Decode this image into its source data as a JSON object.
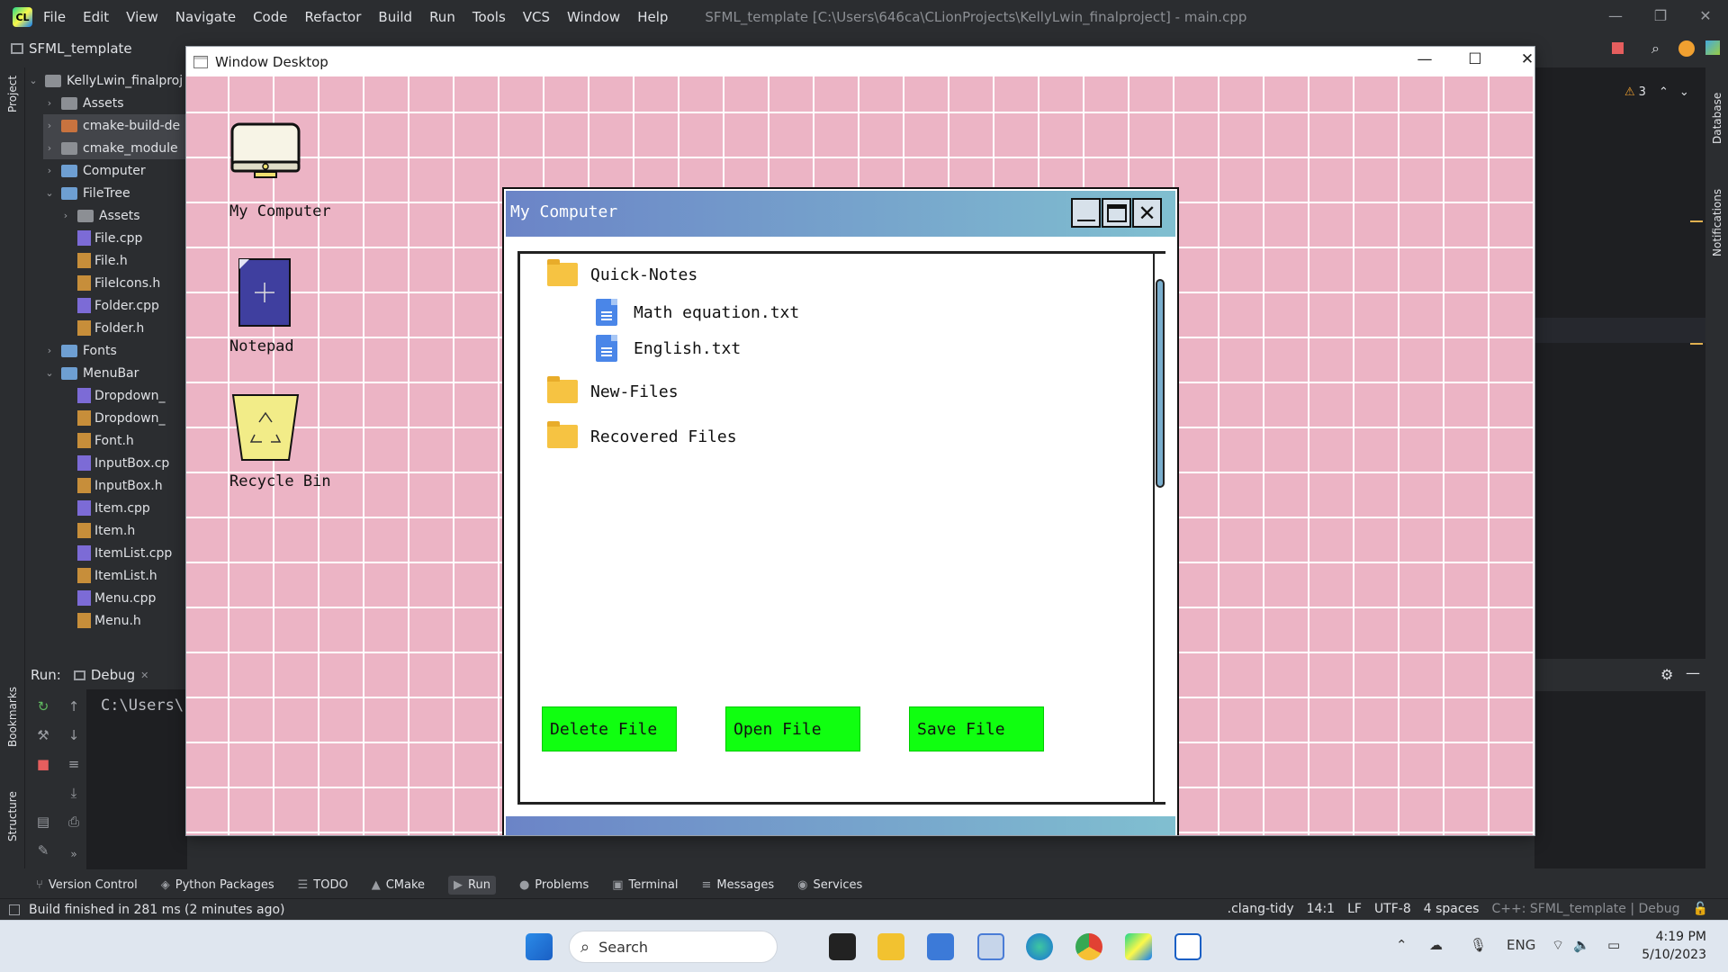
{
  "ide": {
    "menu": [
      "File",
      "Edit",
      "View",
      "Navigate",
      "Code",
      "Refactor",
      "Build",
      "Run",
      "Tools",
      "VCS",
      "Window",
      "Help"
    ],
    "title": "SFML_template [C:\\Users\\646ca\\CLionProjects\\KellyLwin_finalproject] - main.cpp",
    "project_name": "SFML_template",
    "project_panel_label": "Project",
    "tree": [
      {
        "label": "KellyLwin_finalproj",
        "kind": "folder-gray",
        "depth": 0,
        "state": "open"
      },
      {
        "label": "Assets",
        "kind": "folder-gray",
        "depth": 1,
        "state": "closed"
      },
      {
        "label": "cmake-build-de",
        "kind": "folder-orange",
        "depth": 1,
        "state": "closed"
      },
      {
        "label": "cmake_module",
        "kind": "folder-gray",
        "depth": 1,
        "state": "closed"
      },
      {
        "label": "Computer",
        "kind": "folder",
        "depth": 1,
        "state": "closed"
      },
      {
        "label": "FileTree",
        "kind": "folder",
        "depth": 1,
        "state": "open"
      },
      {
        "label": "Assets",
        "kind": "folder-gray",
        "depth": 2,
        "state": "closed"
      },
      {
        "label": "File.cpp",
        "kind": "cpp",
        "depth": 2
      },
      {
        "label": "File.h",
        "kind": "h",
        "depth": 2
      },
      {
        "label": "FileIcons.h",
        "kind": "h",
        "depth": 2
      },
      {
        "label": "Folder.cpp",
        "kind": "cpp",
        "depth": 2
      },
      {
        "label": "Folder.h",
        "kind": "h",
        "depth": 2
      },
      {
        "label": "Fonts",
        "kind": "folder",
        "depth": 1,
        "state": "closed"
      },
      {
        "label": "MenuBar",
        "kind": "folder",
        "depth": 1,
        "state": "open"
      },
      {
        "label": "Dropdown_",
        "kind": "cpp",
        "depth": 2
      },
      {
        "label": "Dropdown_",
        "kind": "h",
        "depth": 2
      },
      {
        "label": "Font.h",
        "kind": "h",
        "depth": 2
      },
      {
        "label": "InputBox.cp",
        "kind": "cpp",
        "depth": 2
      },
      {
        "label": "InputBox.h",
        "kind": "h",
        "depth": 2
      },
      {
        "label": "Item.cpp",
        "kind": "cpp",
        "depth": 2
      },
      {
        "label": "Item.h",
        "kind": "h",
        "depth": 2
      },
      {
        "label": "ItemList.cpp",
        "kind": "cpp",
        "depth": 2
      },
      {
        "label": "ItemList.h",
        "kind": "h",
        "depth": 2
      },
      {
        "label": "Menu.cpp",
        "kind": "cpp",
        "depth": 2
      },
      {
        "label": "Menu.h",
        "kind": "h",
        "depth": 2
      }
    ],
    "run_label": "Run:",
    "run_tab": "Debug",
    "console_text": "C:\\Users\\",
    "side_labels": {
      "project": "Project",
      "bookmarks": "Bookmarks",
      "structure": "Structure",
      "database": "Database",
      "notifications": "Notifications"
    },
    "warnings_count": "3",
    "tool_tabs": [
      {
        "label": "Version Control",
        "icon": "branch-icon"
      },
      {
        "label": "Python Packages",
        "icon": "layers-icon"
      },
      {
        "label": "TODO",
        "icon": "list-icon"
      },
      {
        "label": "CMake",
        "icon": "triangle-icon"
      },
      {
        "label": "Run",
        "icon": "play-icon",
        "active": true
      },
      {
        "label": "Problems",
        "icon": "info-icon"
      },
      {
        "label": "Terminal",
        "icon": "terminal-icon"
      },
      {
        "label": "Messages",
        "icon": "menu-icon"
      },
      {
        "label": "Services",
        "icon": "play-circle-icon"
      }
    ],
    "status": {
      "message": "Build finished in 281 ms (2 minutes ago)",
      "right": [
        ".clang-tidy",
        "14:1",
        "LF",
        "UTF-8",
        "4 spaces",
        "C++: SFML_template | Debug"
      ]
    }
  },
  "sfml": {
    "window_title": "Window Desktop",
    "desktop_icons": [
      {
        "label": "My Computer",
        "icon": "monitor-icon"
      },
      {
        "label": "Notepad",
        "icon": "notepad-icon"
      },
      {
        "label": "Recycle Bin",
        "icon": "recycle-bin-icon"
      }
    ],
    "my_computer": {
      "title": "My Computer",
      "tree": [
        {
          "label": "Quick-Notes",
          "type": "folder",
          "depth": 0
        },
        {
          "label": "Math equation.txt",
          "type": "file",
          "depth": 1
        },
        {
          "label": "English.txt",
          "type": "file",
          "depth": 1
        },
        {
          "label": "New-Files",
          "type": "folder",
          "depth": 0
        },
        {
          "label": "Recovered Files",
          "type": "folder",
          "depth": 0
        }
      ],
      "buttons": [
        "Delete File",
        "Open File",
        "Save File"
      ],
      "button_color": "#10ff10",
      "titlebar_gradient": [
        "#6b84c7",
        "#80bfd0"
      ]
    }
  },
  "taskbar": {
    "search_placeholder": "Search",
    "language": "ENG",
    "time": "4:19 PM",
    "date": "5/10/2023"
  }
}
